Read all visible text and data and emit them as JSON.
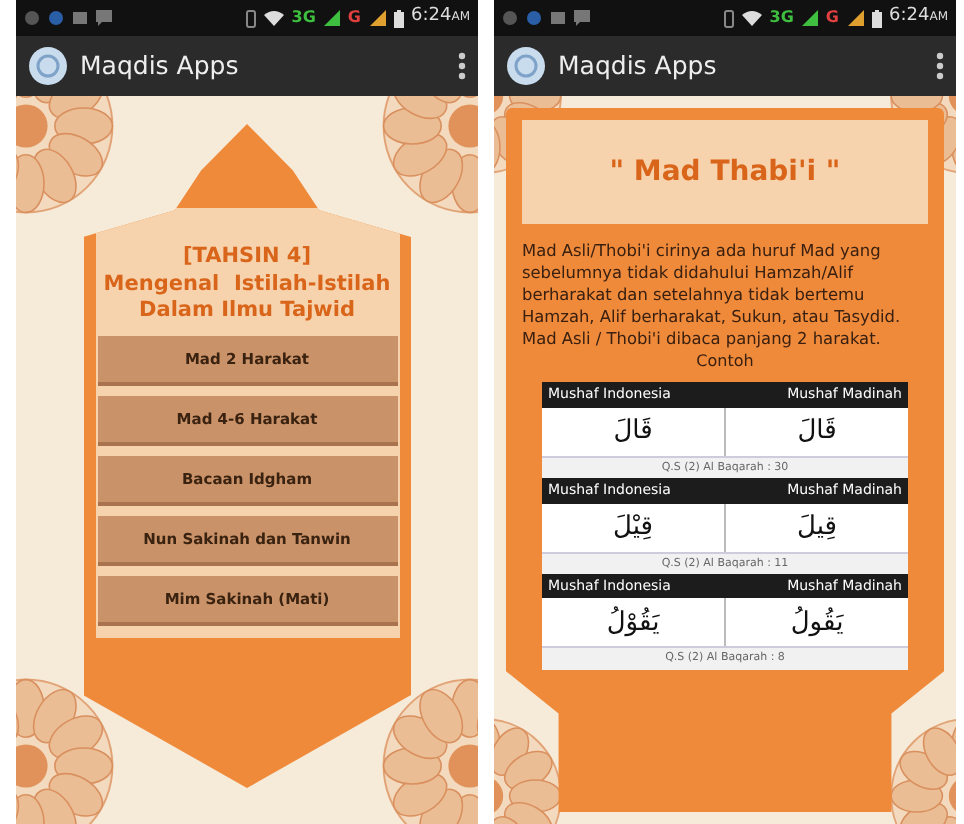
{
  "menu_screen": {
    "status_bar": {
      "network_1": "3G",
      "network_2": "G",
      "time": "6:24",
      "meridiem": "AM"
    },
    "app_bar": {
      "title": "Maqdis Apps"
    },
    "heading": [
      "[TAHSIN 4]",
      "Mengenal  Istilah-Istilah",
      "Dalam Ilmu Tajwid"
    ],
    "menu_items": [
      "Mad 2 Harakat",
      "Mad 4-6 Harakat",
      "Bacaan Idgham",
      "Nun Sakinah dan Tanwin",
      "Mim Sakinah (Mati)"
    ]
  },
  "detail_screen": {
    "status_bar": {
      "network_1": "3G",
      "network_2": "G",
      "time": "6:24",
      "meridiem": "AM"
    },
    "app_bar": {
      "title": "Maqdis Apps"
    },
    "heading": "\" Mad Thabi'i \"",
    "paragraph": "Mad Asli/Thobi'i cirinya ada huruf Mad yang sebelumnya tidak didahului Hamzah/Alif berharakat dan setelahnya tidak bertemu Hamzah, Alif berharakat, Sukun, atau Tasydid. Mad Asli / Thobi'i dibaca panjang 2 harakat.",
    "caption": "Contoh",
    "examples": [
      {
        "column_1": "Mushaf Indonesia",
        "column_2": "Mushaf Madinah",
        "word_1": "قَالَ",
        "word_2": "قَالَ",
        "reference": "Q.S (2) Al Baqarah : 30"
      },
      {
        "column_1": "Mushaf Indonesia",
        "column_2": "Mushaf Madinah",
        "word_1": "قِيْلَ",
        "word_2": "قِيلَ",
        "reference": "Q.S (2) Al Baqarah : 11"
      },
      {
        "column_1": "Mushaf Indonesia",
        "column_2": "Mushaf Madinah",
        "word_1": "يَقُوْلُ",
        "word_2": "يَقُولُ",
        "reference": "Q.S (2) Al Baqarah : 8"
      }
    ]
  }
}
